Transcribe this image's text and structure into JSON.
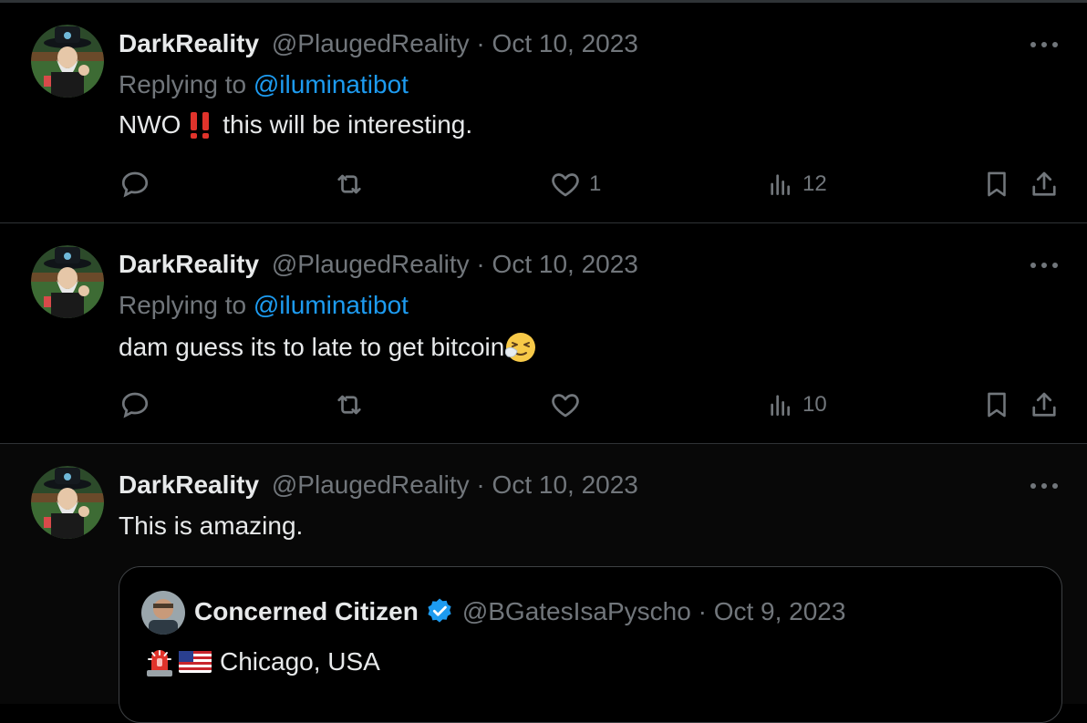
{
  "tweets": [
    {
      "display_name": "DarkReality",
      "handle": "@PlaugedReality",
      "separator": " · ",
      "date": "Oct 10, 2023",
      "replying_prefix": "Replying to ",
      "replying_handle": "@iluminatibot",
      "text": "NWO",
      "emoji_text_after": " this will be interesting.",
      "emoji": "double-exclamation-mark",
      "likes": "1",
      "views": "12"
    },
    {
      "display_name": "DarkReality",
      "handle": "@PlaugedReality",
      "separator": " · ",
      "date": "Oct 10, 2023",
      "replying_prefix": "Replying to ",
      "replying_handle": "@iluminatibot",
      "text": "dam guess its to late to get bitcoin",
      "emoji": "sneezing-face",
      "likes": "",
      "views": "10"
    },
    {
      "display_name": "DarkReality",
      "handle": "@PlaugedReality",
      "separator": " · ",
      "date": "Oct 10, 2023",
      "text": "This is amazing."
    }
  ],
  "quote": {
    "display_name": "Concerned Citizen",
    "verified": true,
    "handle": "@BGatesIsaPyscho",
    "separator": " · ",
    "date": "Oct 9, 2023",
    "emojis": [
      "police-light",
      "us-flag"
    ],
    "text": "Chicago, USA"
  },
  "icons": [
    "more-icon",
    "reply-icon",
    "retweet-icon",
    "like-icon",
    "views-icon",
    "bookmark-icon",
    "share-icon",
    "verified-badge-icon"
  ],
  "colors": {
    "background": "#000000",
    "text": "#e7e9ea",
    "muted": "#71767b",
    "link": "#1d9bf0",
    "divider": "#2f3336"
  }
}
